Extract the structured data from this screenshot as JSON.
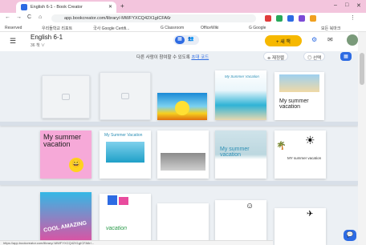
{
  "browser": {
    "tab_title": "English 6-1 - Book Creator",
    "new_tab": "+",
    "window_controls": [
      "–",
      "□",
      "✕"
    ],
    "nav": [
      "←",
      "→",
      "C",
      "⌂"
    ],
    "url": "app.bookcreator.com/library/-MWFYXCQ42X1gICFA6r",
    "extensions": [
      "#e03b3b",
      "#28a85a",
      "#2d6be3",
      "#7c4bd6",
      "#f0a020"
    ],
    "bookmarks": [
      "Reserved",
      "우리들학교 리포트",
      "국사 Google Certifi...",
      "G Classroom",
      "OfficeWiki",
      "G Google",
      "모든 북마크"
    ]
  },
  "app": {
    "title": "English 6-1",
    "subtitle": "36 책 ∨",
    "view_toggle_active": "▦",
    "view_toggle_other": "👥",
    "new_button": "+ 새 책",
    "notice": "다른 사람이 참여할 수 있도록",
    "notice_link": "초대 코드",
    "controls": [
      "⌯ 재정렬",
      "◎ 선택"
    ],
    "grid_icon": "▦"
  },
  "books": [
    {
      "label": "",
      "style": "blank"
    },
    {
      "label": "",
      "style": "blank"
    },
    {
      "label": "",
      "style": "sunset"
    },
    {
      "label": "My Summer Vacation",
      "style": "beach-cover"
    },
    {
      "label": "My summer vacation",
      "style": "white-photo"
    },
    {
      "label": "My summer vacation",
      "style": "pink-emoji"
    },
    {
      "label": "My Summer Vacation",
      "style": "beach-photo"
    },
    {
      "label": "",
      "style": "book-photo"
    },
    {
      "label": "My summer vacation",
      "style": "beach-title"
    },
    {
      "label": "MY summer vacation",
      "style": "cartoon"
    },
    {
      "label": "COOL AMAZING",
      "style": "comic"
    },
    {
      "label": "vacation",
      "style": "blocks"
    },
    {
      "label": "",
      "style": "white"
    },
    {
      "label": "",
      "style": "smiley"
    },
    {
      "label": "",
      "style": "plane"
    }
  ],
  "status_url": "https://app.bookcreator.com/library/-MWFYXCQ42X1gICFA6r/...",
  "colors": {
    "primary": "#2d6be3",
    "new_button": "#f6b800",
    "bg": "#ecf0f4"
  }
}
